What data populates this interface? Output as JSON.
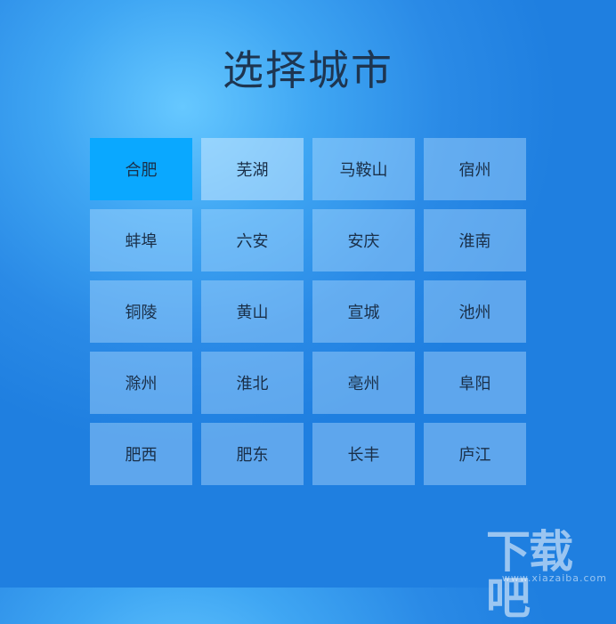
{
  "page": {
    "title": "选择城市"
  },
  "cities": [
    {
      "label": "合肥",
      "selected": true
    },
    {
      "label": "芜湖"
    },
    {
      "label": "马鞍山"
    },
    {
      "label": "宿州"
    },
    {
      "label": "蚌埠"
    },
    {
      "label": "六安"
    },
    {
      "label": "安庆"
    },
    {
      "label": "淮南"
    },
    {
      "label": "铜陵"
    },
    {
      "label": "黄山"
    },
    {
      "label": "宣城"
    },
    {
      "label": "池州"
    },
    {
      "label": "滁州"
    },
    {
      "label": "淮北"
    },
    {
      "label": "亳州"
    },
    {
      "label": "阜阳"
    },
    {
      "label": "肥西"
    },
    {
      "label": "肥东"
    },
    {
      "label": "长丰"
    },
    {
      "label": "庐江"
    }
  ],
  "colors": {
    "selected": "#0aa8ff",
    "title": "#1e3550"
  },
  "watermark": {
    "text": "下载吧",
    "sub": "www.xiazaiba.com"
  }
}
